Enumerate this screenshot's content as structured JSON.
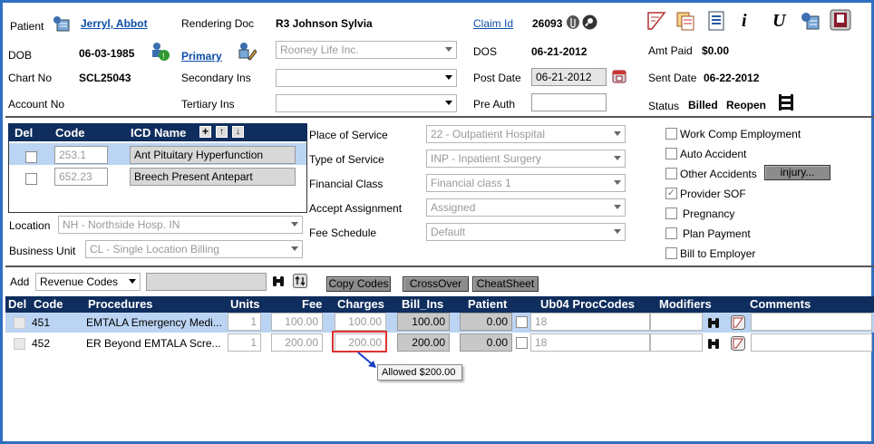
{
  "patient": {
    "label": "Patient",
    "name": "Jerryl, Abbot"
  },
  "rendering": {
    "label": "Rendering Doc",
    "value": "R3 Johnson Sylvia"
  },
  "claim": {
    "label": "Claim Id",
    "value": "26093"
  },
  "dob": {
    "label": "DOB",
    "value": "06-03-1985"
  },
  "primary": {
    "label": "Primary",
    "value": "Rooney Life Inc."
  },
  "dos": {
    "label": "DOS",
    "value": "06-21-2012"
  },
  "amt_paid": {
    "label": "Amt Paid",
    "value": "$0.00"
  },
  "chart": {
    "label": "Chart No",
    "value": "SCL25043"
  },
  "secondary": {
    "label": "Secondary Ins",
    "value": ""
  },
  "post_date": {
    "label": "Post Date",
    "value": "06-21-2012"
  },
  "sent_date": {
    "label": "Sent Date",
    "value": "06-22-2012"
  },
  "account": {
    "label": "Account No"
  },
  "tertiary": {
    "label": "Tertiary Ins",
    "value": ""
  },
  "pre_auth": {
    "label": "Pre Auth",
    "value": ""
  },
  "status": {
    "label": "Status",
    "value": "Billed",
    "reopen": "Reopen"
  },
  "icd": {
    "del": "Del",
    "code": "Code",
    "name": "ICD Name",
    "rows": [
      {
        "code": "253.1",
        "name": "Ant Pituitary Hyperfunction"
      },
      {
        "code": "652.23",
        "name": "Breech Present Antepart"
      }
    ]
  },
  "location": {
    "label": "Location",
    "value": "NH - Northside Hosp. IN"
  },
  "business_unit": {
    "label": "Business Unit",
    "value": "CL - Single Location Billing"
  },
  "pos": {
    "label": "Place of Service",
    "value": "22 - Outpatient Hospital"
  },
  "tos": {
    "label": "Type of Service",
    "value": "INP - Inpatient Surgery"
  },
  "fin_class": {
    "label": "Financial Class",
    "value": "Financial class 1"
  },
  "accept": {
    "label": "Accept Assignment",
    "value": "Assigned"
  },
  "fee_schedule": {
    "label": "Fee Schedule",
    "value": "Default"
  },
  "checks": {
    "work_comp": "Work Comp Employment",
    "auto": "Auto Accident",
    "other": "Other Accidents",
    "injury_btn": "injury...",
    "provider_sof": "Provider SOF",
    "pregnancy": "Pregnancy",
    "plan_payment": "Plan Payment",
    "bill_employer": "Bill to Employer"
  },
  "add": {
    "label": "Add",
    "selected": "Revenue Codes",
    "copy": "Copy Codes",
    "crossover": "CrossOver",
    "cheatsheet": "CheatSheet"
  },
  "proc_headers": {
    "del": "Del",
    "code": "Code",
    "procedures": "Procedures",
    "units": "Units",
    "fee": "Fee",
    "charges": "Charges",
    "bill_ins": "Bill_Ins",
    "patient": "Patient",
    "ub04": "Ub04 ProcCodes",
    "modifiers": "Modifiers",
    "comments": "Comments"
  },
  "procs": [
    {
      "code": "451",
      "proc": "EMTALA Emergency Medi...",
      "units": "1",
      "fee": "100.00",
      "charges": "100.00",
      "bill_ins": "100.00",
      "patient": "0.00",
      "ub04": "18"
    },
    {
      "code": "452",
      "proc": "ER Beyond EMTALA Scre...",
      "units": "1",
      "fee": "200.00",
      "charges": "200.00",
      "bill_ins": "200.00",
      "patient": "0.00",
      "ub04": "18"
    }
  ],
  "tooltip": "Allowed $200.00"
}
